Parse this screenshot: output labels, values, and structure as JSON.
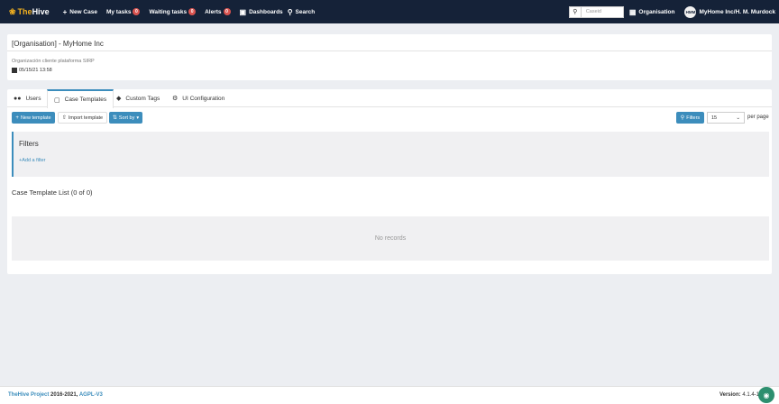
{
  "navbar": {
    "brand_the": "The",
    "brand_hive": "Hive",
    "new_case": "New Case",
    "my_tasks": "My tasks",
    "my_tasks_count": "0",
    "waiting_tasks": "Waiting tasks",
    "waiting_tasks_count": "0",
    "alerts": "Alerts",
    "alerts_count": "0",
    "dashboards": "Dashboards",
    "search": "Search",
    "caseid_placeholder": "Caseid",
    "organisation": "Organisation",
    "avatar_initials": "HMM",
    "user": "MyHome Inc/H. M. Murdock"
  },
  "org": {
    "title": "[Organisation] - MyHome Inc",
    "description": "Organización cliente plataforma SIRP",
    "date": "05/15/21 13:58"
  },
  "tabs": [
    {
      "label": "Users",
      "icon": "users-icon"
    },
    {
      "label": "Case Templates",
      "icon": "file-icon"
    },
    {
      "label": "Custom Tags",
      "icon": "tag-icon"
    },
    {
      "label": "UI Configuration",
      "icon": "cogs-icon"
    }
  ],
  "active_tab": "Case Templates",
  "toolbar": {
    "new_template": "New template",
    "import_template": "Import template",
    "sort_by": "Sort by",
    "filters": "Filters",
    "per_page_value": "15",
    "per_page_label": "per page"
  },
  "filters": {
    "title": "Filters",
    "add_filter": "Add a filter"
  },
  "list": {
    "title": "Case Template List (0 of 0)",
    "empty": "No records"
  },
  "footer": {
    "project": "TheHive Project",
    "years": " 2016-2021, ",
    "license": "AGPL-V3",
    "version_label": "Version:",
    "version": "4.1.4-1"
  },
  "colors": {
    "navbar": "#152238",
    "primary": "#3c8dbc",
    "badge": "#d9534f",
    "chat": "#2d8f6f"
  }
}
